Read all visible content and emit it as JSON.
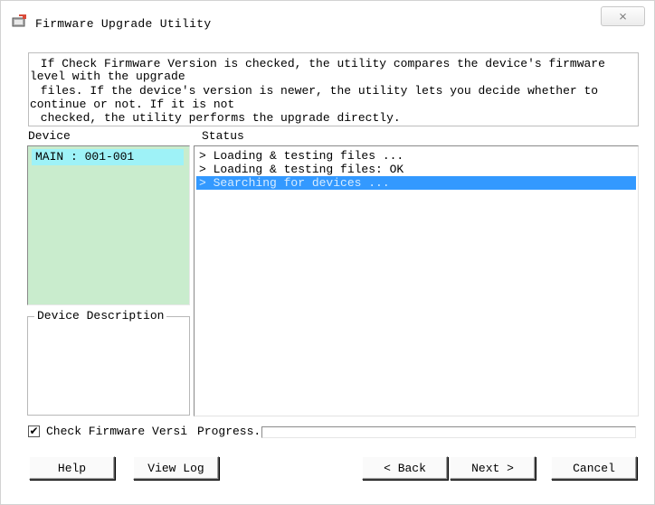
{
  "window": {
    "title": "Firmware Upgrade Utility",
    "close_glyph": "⨯"
  },
  "info": {
    "lines": [
      " If Check Firmware Version is checked, the utility compares the device's firmware",
      "level with the upgrade",
      " files. If the device's version is newer, the utility lets you decide whether to",
      "continue or not. If it is not",
      " checked, the utility performs the upgrade directly."
    ]
  },
  "device": {
    "label": "Device",
    "items": [
      "MAIN : 001-001"
    ],
    "description_label": "Device Description"
  },
  "status": {
    "label": "Status",
    "rows": [
      "> Loading & testing files ...",
      "> Loading & testing files: OK",
      "> Searching for devices ..."
    ],
    "selected_index": 2
  },
  "options": {
    "check_firmware_label": "Check Firmware Versi",
    "check_firmware_checked": true,
    "progress_label": "Progress.",
    "progress_value": 0
  },
  "buttons": {
    "help": "Help",
    "view_log": "View Log",
    "back": "< Back",
    "next": "Next >",
    "cancel": "Cancel"
  },
  "colors": {
    "selection": "#3399ff",
    "device_list_bg": "#c9eccd",
    "device_item_bg": "#9ef2f7"
  }
}
